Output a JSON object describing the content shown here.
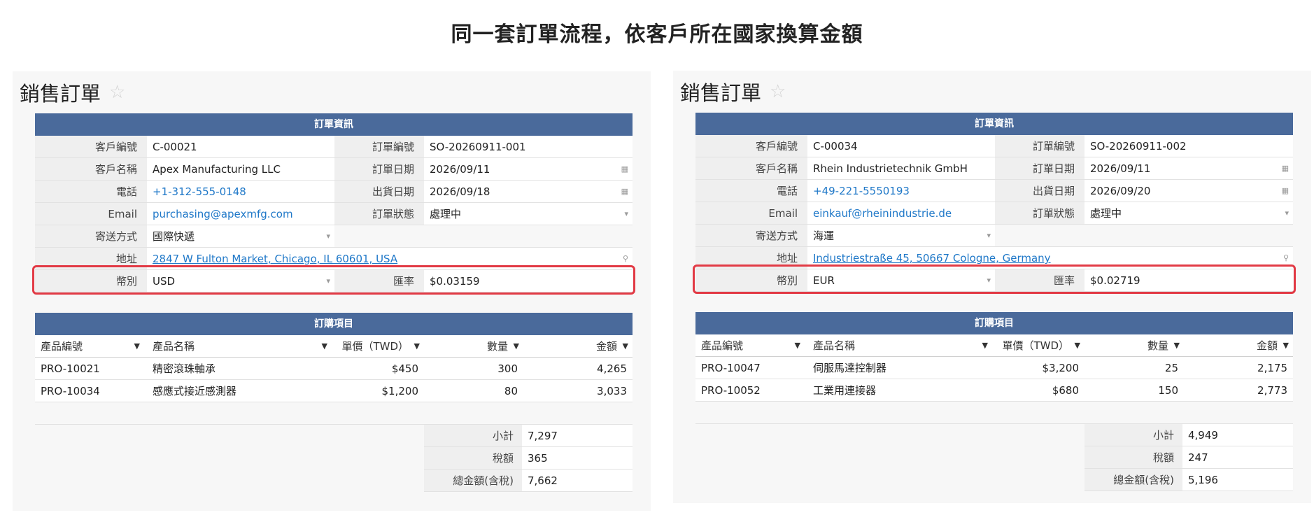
{
  "title": "同一套訂單流程，依客戶所在國家換算金額",
  "panels": [
    {
      "heading": "銷售訂單",
      "info_title": "訂單資訊",
      "labels": {
        "customer_id": "客戶編號",
        "order_no": "訂單編號",
        "customer_name": "客戶名稱",
        "order_date": "訂單日期",
        "phone": "電話",
        "ship_date": "出貨日期",
        "email": "Email",
        "status": "訂單狀態",
        "shipping": "寄送方式",
        "address": "地址",
        "currency": "幣別",
        "rate": "匯率"
      },
      "values": {
        "customer_id": "C-00021",
        "order_no": "SO-20260911-001",
        "customer_name": "Apex Manufacturing LLC",
        "order_date": "2026/09/11",
        "phone": "+1-312-555-0148",
        "ship_date": "2026/09/18",
        "email": "purchasing@apexmfg.com",
        "status": "處理中",
        "shipping": "國際快遞",
        "address": "2847 W Fulton Market, Chicago, IL 60601, USA",
        "currency": "USD",
        "rate": "$0.03159"
      },
      "items_title": "訂購項目",
      "columns": {
        "code": "產品編號",
        "name": "產品名稱",
        "price": "單價（TWD）",
        "qty": "數量",
        "amount": "金額"
      },
      "items": [
        {
          "code": "PRO-10021",
          "name": "精密滾珠軸承",
          "price": "$450",
          "qty": "300",
          "amount": "4,265"
        },
        {
          "code": "PRO-10034",
          "name": "感應式接近感測器",
          "price": "$1,200",
          "qty": "80",
          "amount": "3,033"
        }
      ],
      "totals": [
        {
          "label": "小計",
          "value": "7,297"
        },
        {
          "label": "稅額",
          "value": "365"
        },
        {
          "label": "總金額(含稅)",
          "value": "7,662"
        }
      ]
    },
    {
      "heading": "銷售訂單",
      "info_title": "訂單資訊",
      "labels": {
        "customer_id": "客戶編號",
        "order_no": "訂單編號",
        "customer_name": "客戶名稱",
        "order_date": "訂單日期",
        "phone": "電話",
        "ship_date": "出貨日期",
        "email": "Email",
        "status": "訂單狀態",
        "shipping": "寄送方式",
        "address": "地址",
        "currency": "幣別",
        "rate": "匯率"
      },
      "values": {
        "customer_id": "C-00034",
        "order_no": "SO-20260911-002",
        "customer_name": "Rhein Industrietechnik GmbH",
        "order_date": "2026/09/11",
        "phone": "+49-221-5550193",
        "ship_date": "2026/09/20",
        "email": "einkauf@rheinindustrie.de",
        "status": "處理中",
        "shipping": "海運",
        "address": "Industriestraße 45, 50667 Cologne, Germany",
        "currency": "EUR",
        "rate": "$0.02719"
      },
      "items_title": "訂購項目",
      "columns": {
        "code": "產品編號",
        "name": "產品名稱",
        "price": "單價（TWD）",
        "qty": "數量",
        "amount": "金額"
      },
      "items": [
        {
          "code": "PRO-10047",
          "name": "伺服馬達控制器",
          "price": "$3,200",
          "qty": "25",
          "amount": "2,175"
        },
        {
          "code": "PRO-10052",
          "name": "工業用連接器",
          "price": "$680",
          "qty": "150",
          "amount": "2,773"
        }
      ],
      "totals": [
        {
          "label": "小計",
          "value": "4,949"
        },
        {
          "label": "稅額",
          "value": "247"
        },
        {
          "label": "總金額(含稅)",
          "value": "5,196"
        }
      ]
    }
  ],
  "icons": {
    "star": "star-outline-icon",
    "calendar": "calendar-icon",
    "dropdown": "dropdown-caret-icon",
    "location": "map-pin-icon",
    "sort": "sort-caret-icon"
  },
  "colors": {
    "section_bar": "#4a6a9b",
    "link": "#1f78c8",
    "highlight": "#e23a45"
  }
}
